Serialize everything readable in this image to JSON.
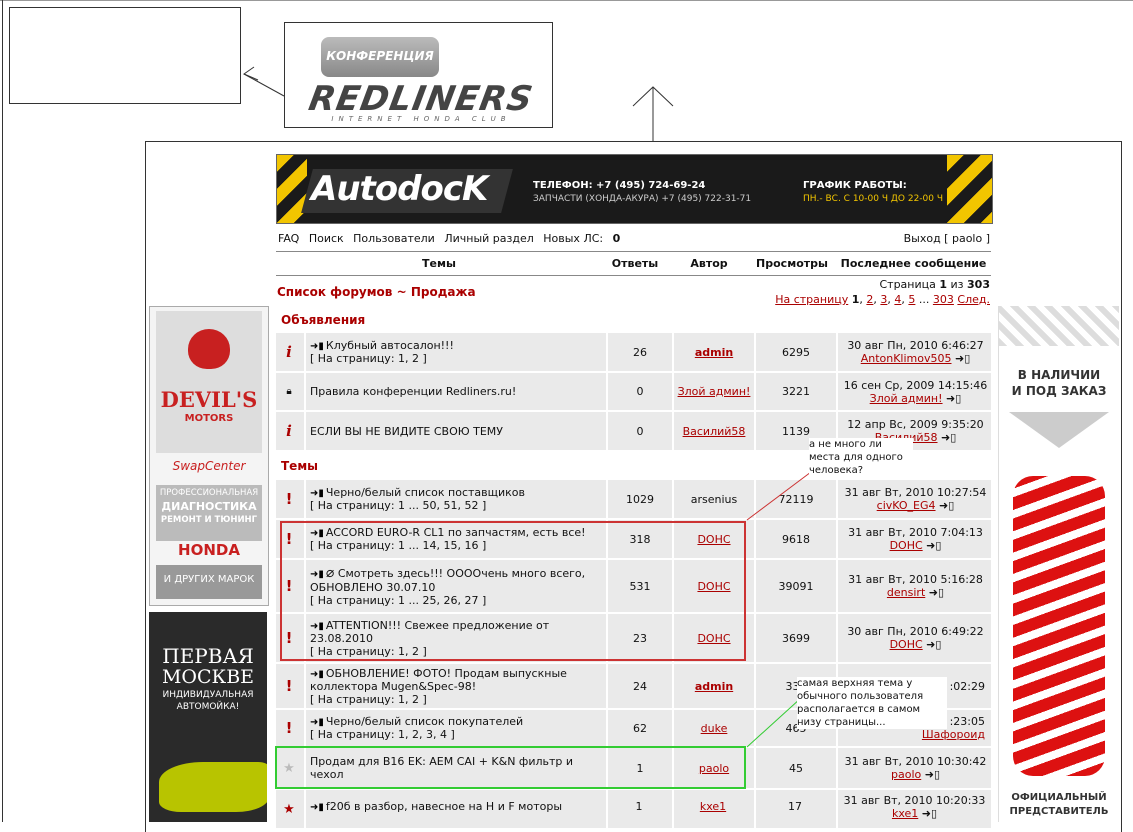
{
  "logo": {
    "top": "КОНФЕРЕНЦИЯ",
    "brand": "REDLINERS",
    "sub": "INTERNET HONDA CLUB"
  },
  "banner": {
    "brand": "AutodocK",
    "phone": "ТЕЛЕФОН: +7 (495) 724-69-24",
    "parts": "ЗАПЧАСТИ (ХОНДА-АКУРА) +7 (495) 722-31-71",
    "sched_title": "ГРАФИК РАБОТЫ:",
    "sched": "ПН.- ВС. С 10-00 Ч ДО 22-00 Ч"
  },
  "nav": {
    "faq": "FAQ",
    "search": "Поиск",
    "users": "Пользователи",
    "personal": "Личный раздел",
    "new_pm": "Новых ЛС:",
    "new_pm_count": "0",
    "logout": "Выход [ paolo ]"
  },
  "columns": {
    "topics": "Темы",
    "replies": "Ответы",
    "author": "Автор",
    "views": "Просмотры",
    "last": "Последнее сообщение"
  },
  "breadcrumb": {
    "list": "Список форумов",
    "sep": "~",
    "forum": "Продажа"
  },
  "paging": {
    "label": "Страница",
    "current": "1",
    "of": "из",
    "total": "303",
    "goto": "На страницу",
    "pages": [
      "1",
      "2",
      "3",
      "4",
      "5",
      "...",
      "303"
    ],
    "next": "След."
  },
  "sections": {
    "announce": "Объявления",
    "topics": "Темы"
  },
  "rows": [
    {
      "title": "Клубный автосалон!!!",
      "pages": "[ На страницу: 1, 2 ]",
      "replies": "26",
      "author": "admin",
      "views": "6295",
      "last_date": "30 авг Пн, 2010 6:46:27",
      "last_user": "AntonKlimov505"
    },
    {
      "title": "Правила конференции Redliners.ru!",
      "pages": "",
      "replies": "0",
      "author": "Злой админ!",
      "views": "3221",
      "last_date": "16 сен Ср, 2009 14:15:46",
      "last_user": "Злой админ!"
    },
    {
      "title": "ЕСЛИ ВЫ НЕ ВИДИТЕ СВОЮ ТЕМУ",
      "pages": "",
      "replies": "0",
      "author": "Василий58",
      "views": "1139",
      "last_date": "12 апр Вс, 2009 9:35:20",
      "last_user": "Василий58"
    },
    {
      "title": "Черно/белый список поставщиков",
      "pages": "[ На страницу: 1 ... 50, 51, 52 ]",
      "replies": "1029",
      "author": "arsenius",
      "views": "72119",
      "last_date": "31 авг Вт, 2010 10:27:54",
      "last_user": "civKO_EG4"
    },
    {
      "title": "ACCORD EURO-R CL1 по запчастям, есть все!",
      "pages": "[ На страницу: 1 ... 14, 15, 16 ]",
      "replies": "318",
      "author": "DOHC",
      "views": "9618",
      "last_date": "31 авг Вт, 2010 7:04:13",
      "last_user": "DOHC"
    },
    {
      "title": "Смотреть здесь!!! ООООчень много всего, ОБНОВЛЕНО 30.07.10",
      "pages": "[ На страницу: 1 ... 25, 26, 27 ]",
      "replies": "531",
      "author": "DOHC",
      "views": "39091",
      "last_date": "31 авг Вт, 2010 5:16:28",
      "last_user": "densirt"
    },
    {
      "title": "ATTENTION!!! Свежее предложение от 23.08.2010",
      "pages": "[ На страницу: 1, 2 ]",
      "replies": "23",
      "author": "DOHC",
      "views": "3699",
      "last_date": "30 авг Пн, 2010 6:49:22",
      "last_user": "DOHC"
    },
    {
      "title": "ОБНОВЛЕНИЕ! ФОТО! Продам выпускные коллектора Mugen&Spec-98!",
      "pages": "[ На страницу: 1, 2 ]",
      "replies": "24",
      "author": "admin",
      "views": "331",
      "last_date": ":02:29",
      "last_user": ""
    },
    {
      "title": "Черно/белый список покупателей",
      "pages": "[ На страницу: 1, 2, 3, 4 ]",
      "replies": "62",
      "author": "duke",
      "views": "465",
      "last_date": ":23:05",
      "last_user": "Шафороид"
    },
    {
      "title": "Продам для B16 EK: AEM CAI + K&N фильтр и чехол",
      "pages": "",
      "replies": "1",
      "author": "paolo",
      "views": "45",
      "last_date": "31 авг Вт, 2010 10:30:42",
      "last_user": "paolo"
    },
    {
      "title": "f20б в разбор, навесное на H и F моторы",
      "pages": "",
      "replies": "1",
      "author": "kxe1",
      "views": "17",
      "last_date": "31 авг Вт, 2010 10:20:33",
      "last_user": "kxe1"
    }
  ],
  "notes": {
    "one": "а не много ли места для одного человека?",
    "two": "самая верхняя тема у обычного пользователя располагается в самом низу страницы..."
  },
  "ads": {
    "devils": "DEVIL'S",
    "motors": "MOTORS",
    "swap": "SwapCenter",
    "diag1": "ПРОФЕССИОНАЛЬНАЯ",
    "diag2": "ДИАГНОСТИКА",
    "diag3": "РЕМОНТ И ТЮНИНГ",
    "honda": "HONDA",
    "others": "И ДРУГИХ МАРОК",
    "wash1": "ПЕРВАЯ",
    "wash2": "МОСКВЕ",
    "wash3": "ИНДИВИДУАЛЬНАЯ",
    "wash4": "АВТОМОЙКА!",
    "stock1": "В НАЛИЧИИ",
    "stock2": "И ПОД ЗАКАЗ",
    "official1": "ОФИЦИАЛЬНЫЙ",
    "official2": "ПРЕДСТАВИТЕЛЬ"
  },
  "colors": {
    "accent": "#aa0000",
    "row_bg": "#eaeaea",
    "highlight_red": "#cc3333",
    "highlight_green": "#33cc33",
    "banner_yellow": "#f2c500"
  }
}
